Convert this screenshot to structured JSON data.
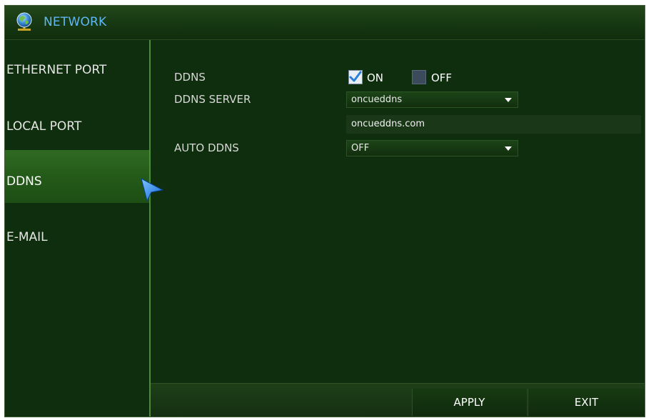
{
  "window": {
    "title": "NETWORK",
    "title_icon": "globe-network-icon"
  },
  "sidebar": {
    "items": [
      {
        "label": "ETHERNET PORT",
        "active": false
      },
      {
        "label": "LOCAL PORT",
        "active": false
      },
      {
        "label": "DDNS",
        "active": true
      },
      {
        "label": "E-MAIL",
        "active": false
      }
    ],
    "pointer_icon": "arrow-cursor-icon"
  },
  "form": {
    "ddns": {
      "label": "DDNS",
      "on_label": "ON",
      "on_checked": true,
      "off_label": "OFF",
      "off_checked": false
    },
    "ddns_server": {
      "label": "DDNS SERVER",
      "selected": "oncueddns",
      "host_value": "oncueddns.com"
    },
    "auto_ddns": {
      "label": "AUTO DDNS",
      "selected": "OFF"
    }
  },
  "footer": {
    "apply_label": "APPLY",
    "exit_label": "EXIT"
  },
  "colors": {
    "background": "#0f2e0d",
    "accent_title": "#5fb8f2",
    "sidebar_active": "#2f6a22",
    "divider": "#4a8c3a"
  }
}
